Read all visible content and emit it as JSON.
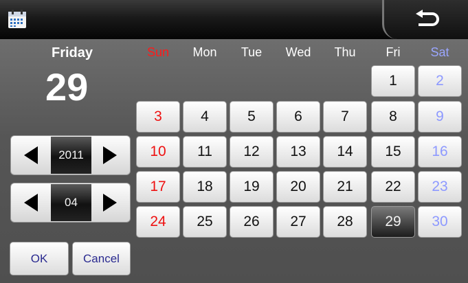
{
  "header": {
    "calendar_icon": "calendar-icon",
    "back_icon": "back-arrow-icon"
  },
  "selected": {
    "weekday": "Friday",
    "day": "29"
  },
  "weekdays": [
    "Sun",
    "Mon",
    "Tue",
    "Wed",
    "Thu",
    "Fri",
    "Sat"
  ],
  "days": {
    "d1": "1",
    "d2": "2",
    "d3": "3",
    "d4": "4",
    "d5": "5",
    "d6": "6",
    "d7": "7",
    "d8": "8",
    "d9": "9",
    "d10": "10",
    "d11": "11",
    "d12": "12",
    "d13": "13",
    "d14": "14",
    "d15": "15",
    "d16": "16",
    "d17": "17",
    "d18": "18",
    "d19": "19",
    "d20": "20",
    "d21": "21",
    "d22": "22",
    "d23": "23",
    "d24": "24",
    "d25": "25",
    "d26": "26",
    "d27": "27",
    "d28": "28",
    "d29": "29",
    "d30": "30"
  },
  "year_spinner": {
    "value": "2011"
  },
  "month_spinner": {
    "value": "04"
  },
  "buttons": {
    "ok": "OK",
    "cancel": "Cancel"
  },
  "colors": {
    "sunday": "#e11111",
    "saturday": "#8d99ff",
    "selected_bg": "#1c1c1c"
  }
}
